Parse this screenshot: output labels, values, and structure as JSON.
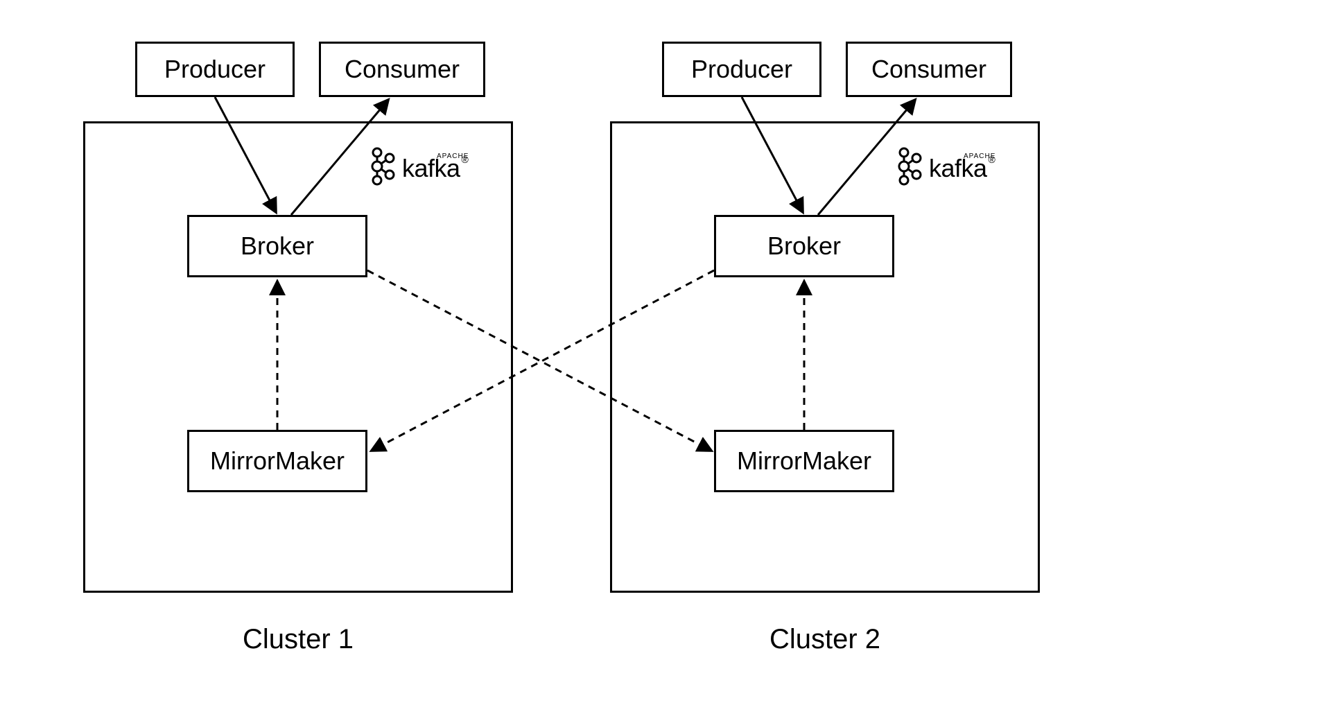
{
  "clusters": [
    {
      "name": "Cluster 1",
      "producer": "Producer",
      "consumer": "Consumer",
      "broker": "Broker",
      "mirrormaker": "MirrorMaker",
      "kafka_brand_small": "APACHE",
      "kafka_brand": "kafka"
    },
    {
      "name": "Cluster 2",
      "producer": "Producer",
      "consumer": "Consumer",
      "broker": "Broker",
      "mirrormaker": "MirrorMaker",
      "kafka_brand_small": "APACHE",
      "kafka_brand": "kafka"
    }
  ],
  "diagram": {
    "edges": [
      {
        "from": "cluster1.producer",
        "to": "cluster1.broker",
        "style": "solid"
      },
      {
        "from": "cluster1.broker",
        "to": "cluster1.consumer",
        "style": "solid"
      },
      {
        "from": "cluster1.mirrormaker",
        "to": "cluster1.broker",
        "style": "dashed"
      },
      {
        "from": "cluster2.producer",
        "to": "cluster2.broker",
        "style": "solid"
      },
      {
        "from": "cluster2.broker",
        "to": "cluster2.consumer",
        "style": "solid"
      },
      {
        "from": "cluster2.mirrormaker",
        "to": "cluster2.broker",
        "style": "dashed"
      },
      {
        "from": "cluster1.broker",
        "to": "cluster2.mirrormaker",
        "style": "dashed"
      },
      {
        "from": "cluster2.broker",
        "to": "cluster1.mirrormaker",
        "style": "dashed"
      }
    ]
  }
}
